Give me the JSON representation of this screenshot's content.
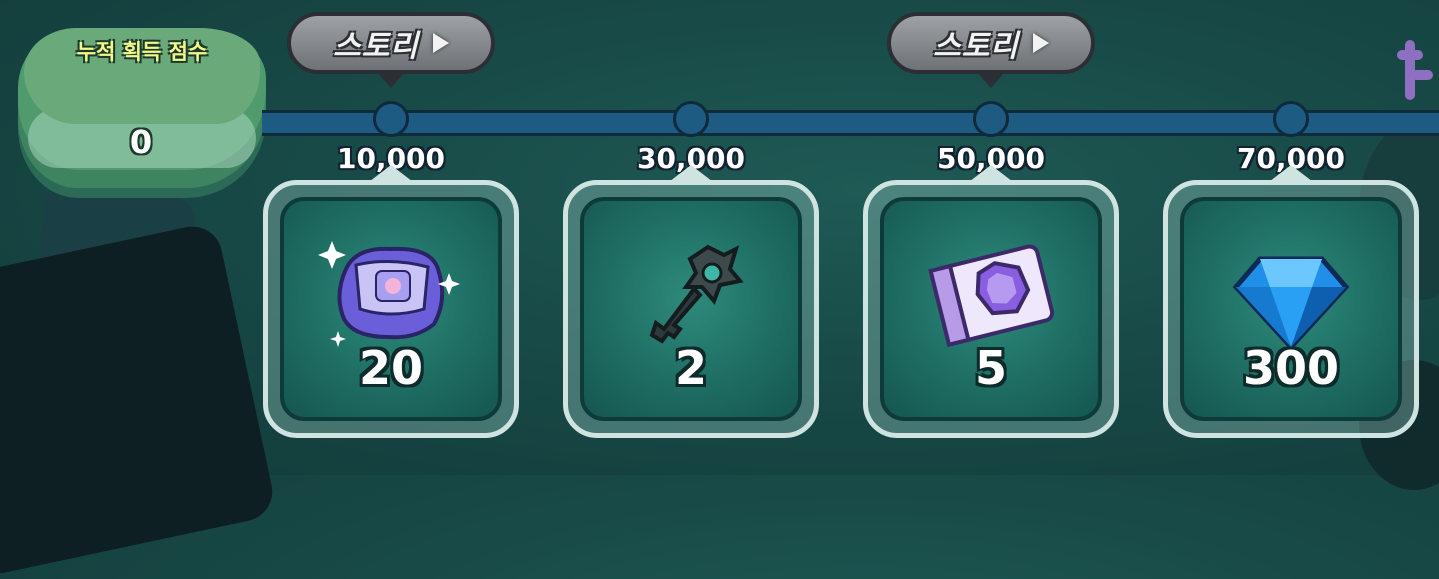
{
  "score": {
    "label": "누적 획득 점수",
    "value": "0"
  },
  "story_buttons": [
    {
      "label": "스토리"
    },
    {
      "label": "스토리"
    }
  ],
  "rewards": [
    {
      "threshold": "10,000",
      "quantity": "20",
      "icon": "soulstone-icon"
    },
    {
      "threshold": "30,000",
      "quantity": "2",
      "icon": "key-icon"
    },
    {
      "threshold": "50,000",
      "quantity": "5",
      "icon": "ticket-icon"
    },
    {
      "threshold": "70,000",
      "quantity": "300",
      "icon": "crystal-icon"
    }
  ],
  "colors": {
    "track": "#1e5b83",
    "card_border": "#cfe4e0",
    "score_label": "#f4f88a"
  }
}
